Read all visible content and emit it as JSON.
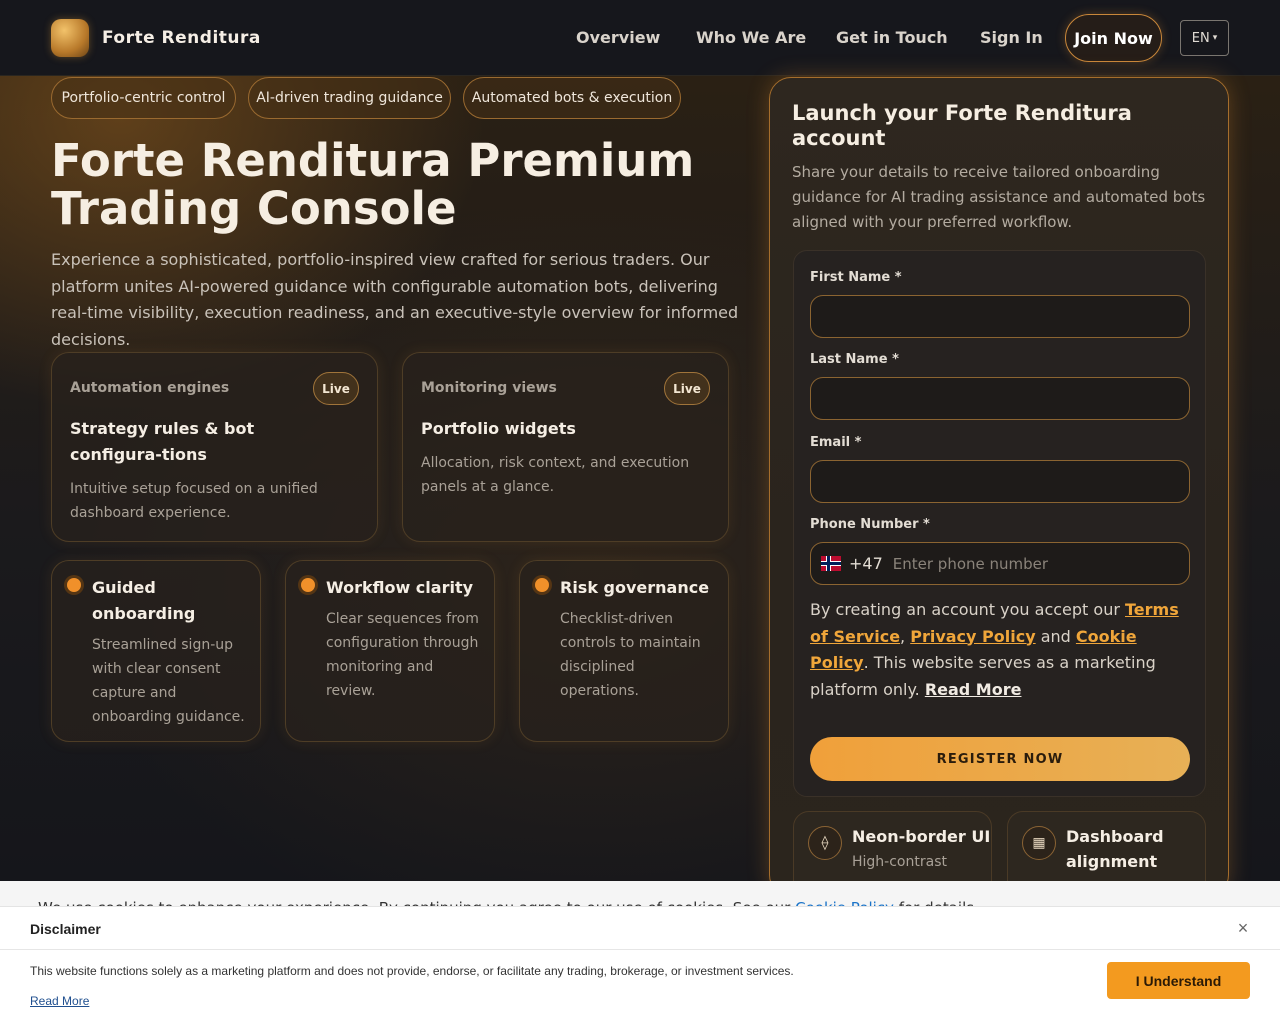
{
  "header": {
    "brand": "Forte Renditura",
    "nav": [
      "Overview",
      "Who We Are",
      "Get in Touch",
      "Sign In"
    ],
    "join_label": "Join Now",
    "lang": "EN",
    "lang_caret": "▾"
  },
  "hero": {
    "pills": [
      "Portfolio-centric control",
      "AI-driven trading guidance",
      "Automated bots & execution"
    ],
    "title": "Forte Renditura Premium Trading Console",
    "description": "Experience a sophisticated, portfolio-inspired view crafted for serious traders. Our platform unites AI-powered guidance with configurable automation bots, delivering real-time visibility, execution readiness, and an executive-style overview for informed decisions.",
    "cards": [
      {
        "kicker": "Automation engines",
        "badge": "Live",
        "title": "Strategy rules & bot configura-tions",
        "body": "Intuitive setup focused on a unified dashboard experience."
      },
      {
        "kicker": "Monitoring views",
        "badge": "Live",
        "title": "Portfolio widgets",
        "body": "Allocation, risk context, and execution panels at a glance."
      }
    ],
    "features": [
      {
        "title": "Guided onboarding",
        "body": "Streamlined sign-up with clear consent capture and onboarding guidance."
      },
      {
        "title": "Workflow clarity",
        "body": "Clear sequences from configuration through monitoring and review."
      },
      {
        "title": "Risk governance",
        "body": "Checklist-driven controls to maintain disciplined operations."
      }
    ]
  },
  "form": {
    "title": "Launch your Forte Renditura account",
    "subtitle": "Share your details to receive tailored onboarding guidance for AI trading assistance and automated bots aligned with your preferred workflow.",
    "first_name_label": "First Name *",
    "last_name_label": "Last Name *",
    "email_label": "Email *",
    "phone_label": "Phone Number *",
    "first_name_value": "",
    "last_name_value": "",
    "email_value": "",
    "dial_code": "+47",
    "phone_placeholder": "Enter phone number",
    "consent_prefix": "By creating an account you accept our ",
    "terms": "Terms of Service",
    "comma": ", ",
    "privacy": "Privacy Policy",
    "and": " and ",
    "cookie": "Cookie Policy",
    "consent_suffix": ". This website serves as a marketing platform only. ",
    "read_more": "Read More",
    "register_label": "REGISTER NOW",
    "mini_features": [
      {
        "icon": "⟠",
        "title": "Neon-border UI",
        "body": "High-contrast"
      },
      {
        "icon": "▦",
        "title": "Dashboard alignment",
        "body": ""
      }
    ]
  },
  "cookie_banner": {
    "text": "We use cookies to enhance your experience. By continuing you agree to our use of cookies. See our ",
    "link": "Cookie Policy",
    "end": " for details."
  },
  "disclaimer": {
    "title": "Disclaimer",
    "close": "×",
    "text": "This website functions solely as a marketing platform and does not provide, endorse, or facilitate any trading, brokerage, or investment services.",
    "read_more": "Read More",
    "button": "I Understand"
  },
  "colors": {
    "accent": "#f0a03a",
    "brand_border": "#a66e2c",
    "background": "#14151a"
  }
}
